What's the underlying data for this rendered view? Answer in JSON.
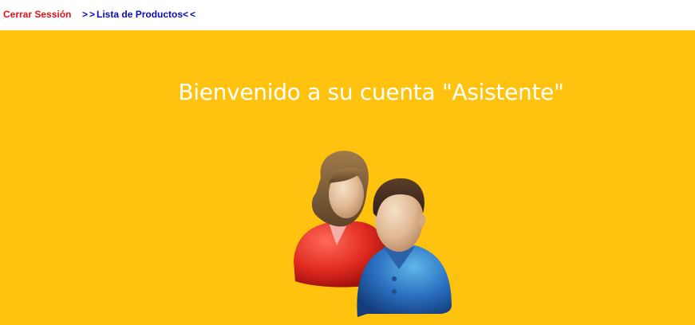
{
  "nav": {
    "logout_label": "Cerrar Sessión",
    "products_prefix": ">>",
    "products_label": "Lista de Productos",
    "products_suffix": "<<"
  },
  "main": {
    "welcome_text": "Bienvenido a su cuenta \"Asistente\"",
    "icon": "users-icon"
  },
  "colors": {
    "banner": "#ffc20e",
    "logout_link": "#e3111b",
    "products_link": "#0a0ab8",
    "welcome_text": "#ffffff"
  }
}
